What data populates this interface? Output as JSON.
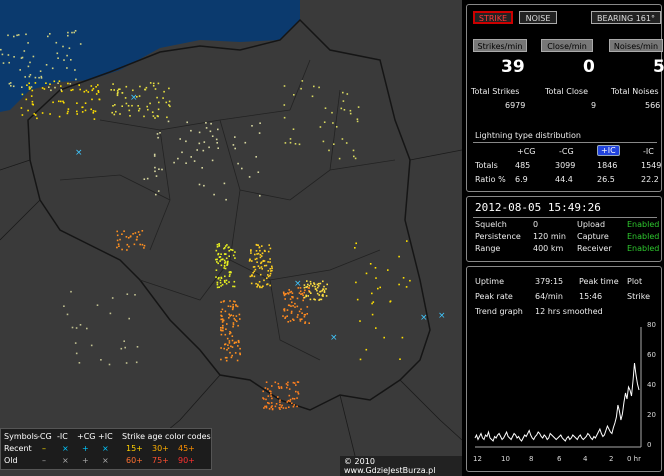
{
  "colors": {
    "map_bg": "#3a3a3a",
    "sea": "#0b3a6e",
    "border": "#1a1a1a",
    "enabled": "#2ec82e",
    "strike_red": "#ff3a3a"
  },
  "top_buttons": {
    "strike": "STRIKE",
    "noise": "NOISE",
    "bearing": "BEARING 161°"
  },
  "counters": {
    "strikes_label": "Strikes/min",
    "close_label": "Close/min",
    "noises_label": "Noises/min",
    "strikes": "39",
    "close": "0",
    "noises": "5",
    "total_strikes_label": "Total Strikes",
    "total_close_label": "Total Close",
    "total_noises_label": "Total Noises",
    "total_strikes": "6979",
    "total_close": "9",
    "total_noises": "566"
  },
  "lightning": {
    "title": "Lightning type distribution",
    "headers": [
      "+CG",
      "-CG",
      "+IC",
      "-IC"
    ],
    "totals_label": "Totals",
    "ratio_label": "Ratio %",
    "totals": [
      "485",
      "3099",
      "1846",
      "1549"
    ],
    "ratio": [
      "6.9",
      "44.4",
      "26.5",
      "22.2"
    ]
  },
  "status": {
    "datetime": "2012-08-05 15:49:26",
    "squelch_label": "Squelch",
    "squelch": "0",
    "persistence_label": "Persistence",
    "persistence": "120 min",
    "range_label": "Range",
    "range": "400 km",
    "upload_label": "Upload",
    "upload": "Enabled",
    "capture_label": "Capture",
    "capture": "Enabled",
    "receiver_label": "Receiver",
    "receiver": "Enabled"
  },
  "stats": {
    "uptime_label": "Uptime",
    "uptime": "379:15",
    "peak_time_label": "Peak time",
    "peak_time": "15:46",
    "plot_label": "Plot",
    "plot": "Strike",
    "peak_rate_label": "Peak rate",
    "peak_rate": "64/min",
    "trend_label": "Trend graph",
    "trend": "12 hrs smoothed"
  },
  "trend_chart": {
    "y_ticks": [
      "80",
      "60",
      "40",
      "20",
      "0"
    ],
    "x_ticks": [
      "12",
      "10",
      "8",
      "6",
      "4",
      "2",
      "0 hr"
    ],
    "values": [
      6,
      8,
      5,
      7,
      9,
      6,
      5,
      8,
      7,
      10,
      6,
      5,
      4,
      7,
      6,
      8,
      9,
      7,
      5,
      6,
      8,
      10,
      7,
      6,
      5,
      7,
      9,
      8,
      6,
      7,
      5,
      4,
      6,
      8,
      7,
      9,
      11,
      8,
      6,
      5,
      7,
      8,
      10,
      9,
      7,
      6,
      8,
      7,
      5,
      6,
      9,
      8,
      7,
      6,
      5,
      6,
      7,
      8,
      6,
      5,
      4,
      6,
      7,
      5,
      6,
      8,
      7,
      6,
      5,
      7,
      8,
      6,
      5,
      6,
      7,
      9,
      8,
      6,
      5,
      7,
      6,
      8,
      10,
      12,
      9,
      7,
      8,
      11,
      14,
      12,
      10,
      9,
      13,
      16,
      20,
      28,
      24,
      18,
      22,
      30,
      36,
      32,
      40,
      38,
      34,
      44,
      56,
      48,
      42,
      38
    ]
  },
  "legend": {
    "symbols_label": "Symbols",
    "types": [
      "-CG",
      "-IC",
      "+CG",
      "+IC"
    ],
    "age_label": "Strike age color codes",
    "recent_label": "Recent",
    "old_label": "Old",
    "recent_symbols": [
      "–",
      "×",
      "+",
      "×"
    ],
    "old_symbols": [
      "–",
      "×",
      "+",
      "×"
    ],
    "recent_ages": [
      "15+",
      "30+",
      "45+"
    ],
    "old_ages": [
      "60+",
      "75+",
      "90+"
    ]
  },
  "copyright": "© 2010 www.GdzieJestBurza.pl"
}
